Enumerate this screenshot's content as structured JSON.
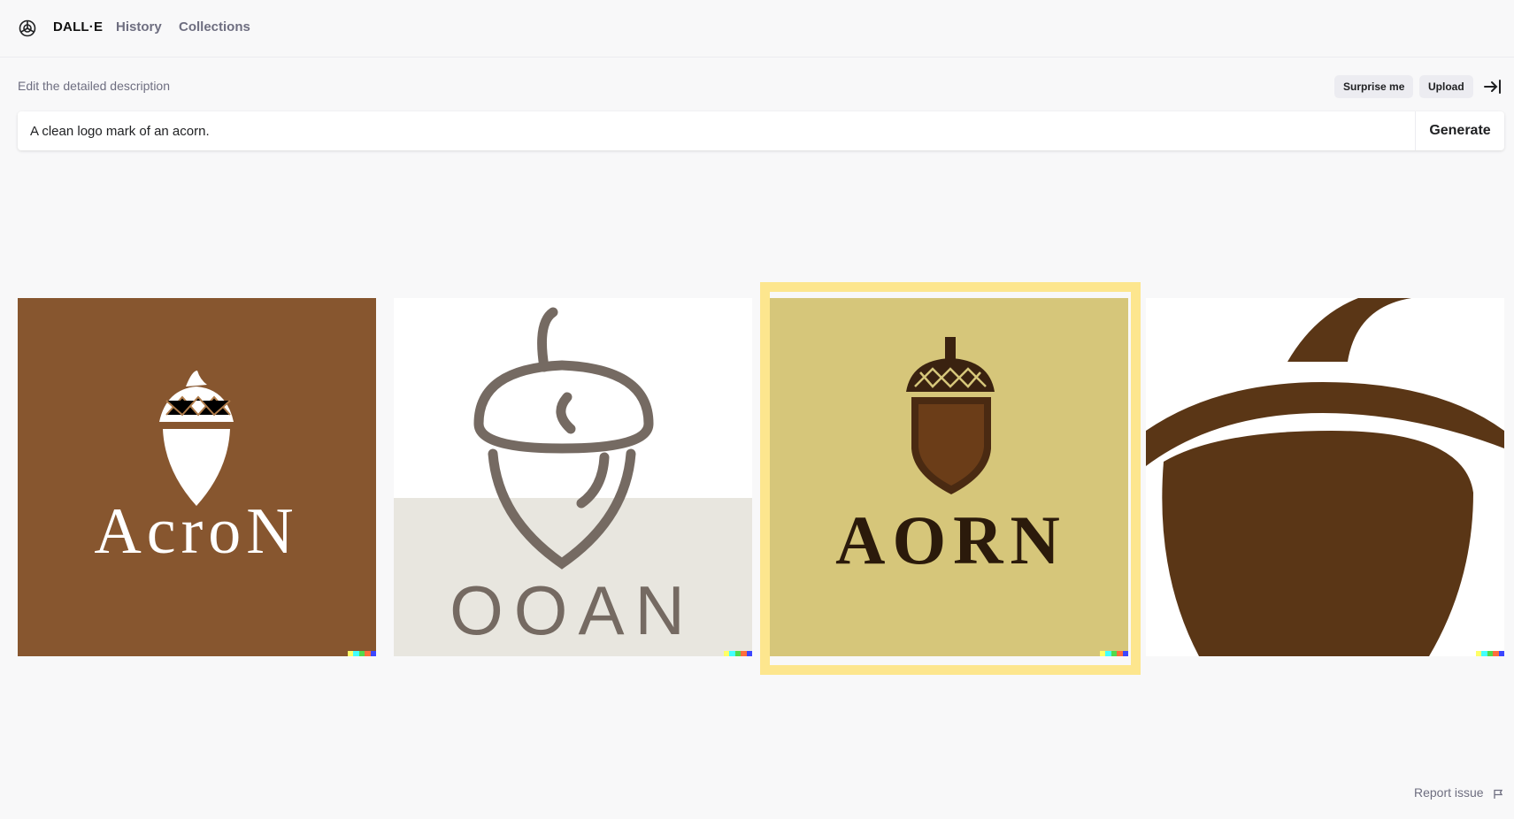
{
  "nav": {
    "brand": "DALL·E",
    "history": "History",
    "collections": "Collections"
  },
  "editor": {
    "label": "Edit the detailed description",
    "surprise": "Surprise me",
    "upload": "Upload",
    "prompt": "A clean logo mark of an acorn.",
    "generate": "Generate"
  },
  "images": [
    {
      "wordmark": "AcroN",
      "bg": "#87562f"
    },
    {
      "wordmark": "OOAN",
      "bg": "#ffffff"
    },
    {
      "wordmark": "AORN",
      "bg": "#d6c67a",
      "selected": true
    },
    {
      "wordmark": "",
      "bg": "#ffffff"
    }
  ],
  "footer": {
    "report": "Report issue"
  },
  "colors": {
    "accent_selection": "#ffe06a",
    "acorn_dark": "#4a2a12"
  }
}
